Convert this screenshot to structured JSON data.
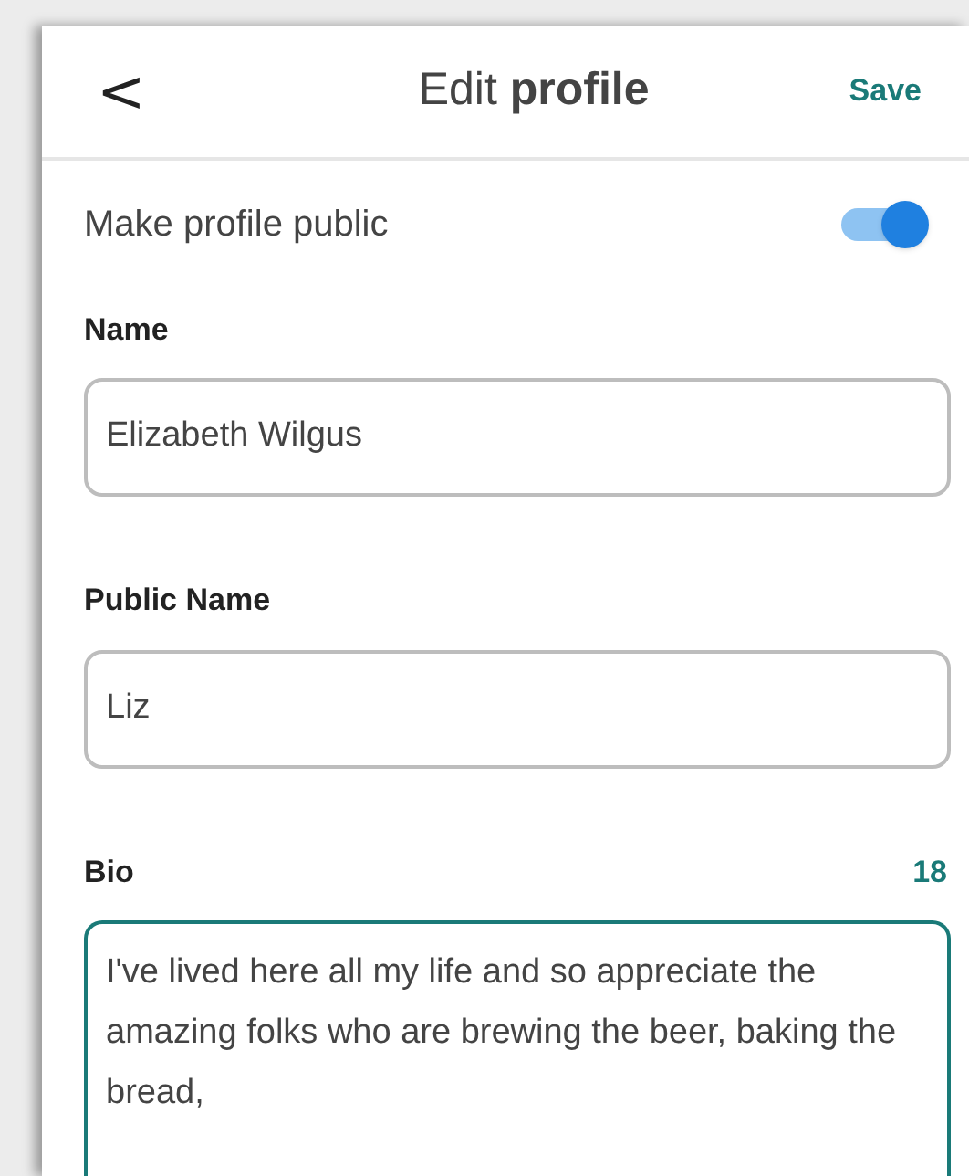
{
  "header": {
    "back": "<",
    "title": "Edit **profile**",
    "save": "Save"
  },
  "public_toggle": {
    "label": "Make profile public",
    "on": true
  },
  "fields": [
    {
      "kind": "input",
      "label": "Name",
      "value": "Elizabeth Wilgus",
      "focused": false
    },
    {
      "kind": "input",
      "label": "Public Name",
      "value": "Liz",
      "focused": false
    },
    {
      "kind": "textarea",
      "label": "Bio",
      "counter": "18",
      "value": "I've lived here all my life and so appreciate the amazing folks who are brewing the beer, baking the bread,",
      "focused": true
    }
  ]
}
